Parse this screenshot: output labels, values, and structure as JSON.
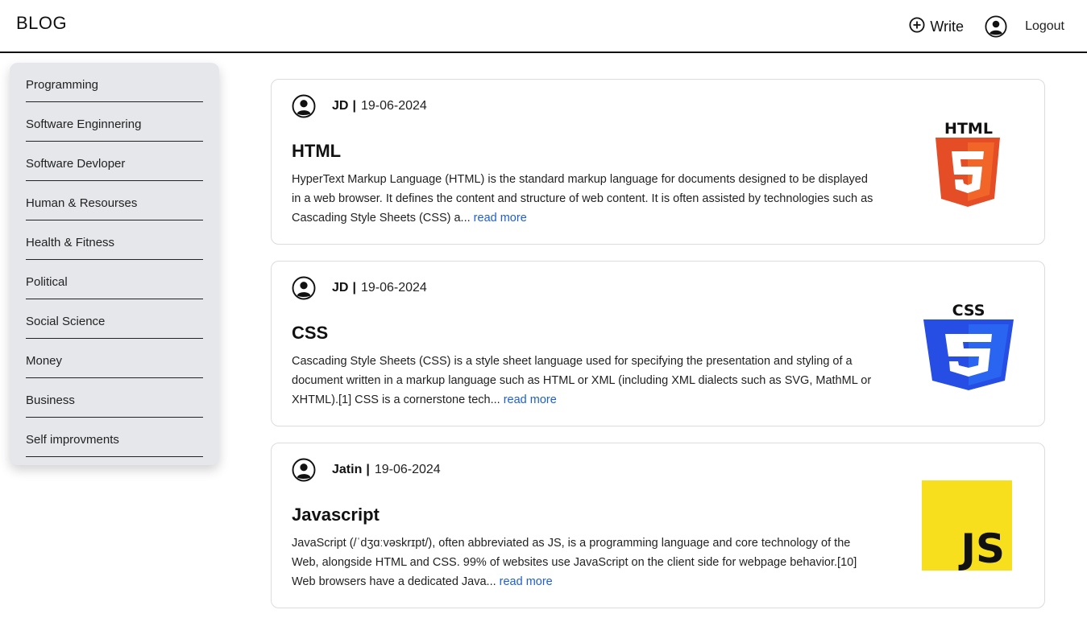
{
  "header": {
    "brand": "BLOG",
    "write_label": "Write",
    "logout_label": "Logout"
  },
  "sidebar": {
    "items": [
      {
        "label": "Programming"
      },
      {
        "label": "Software Enginnering"
      },
      {
        "label": "Software Devloper"
      },
      {
        "label": "Human & Resourses"
      },
      {
        "label": "Health & Fitness"
      },
      {
        "label": "Political"
      },
      {
        "label": "Social Science"
      },
      {
        "label": "Money"
      },
      {
        "label": "Business"
      },
      {
        "label": "Self improvments"
      }
    ]
  },
  "posts": [
    {
      "author": "JD",
      "separator": "|",
      "date": "19-06-2024",
      "title": "HTML",
      "excerpt": "HyperText Markup Language (HTML) is the standard markup language for documents designed to be displayed in a web browser. It defines the content and structure of web content. It is often assisted by technologies such as Cascading Style Sheets (CSS) a...",
      "read_more": "read more",
      "thumbnail": "html5-logo",
      "thumbnail_text": "HTML",
      "thumbnail_color": "#e44d26"
    },
    {
      "author": "JD",
      "separator": "|",
      "date": "19-06-2024",
      "title": "CSS",
      "excerpt": "Cascading Style Sheets (CSS) is a style sheet language used for specifying the presentation and styling of a document written in a markup language such as HTML or XML (including XML dialects such as SVG, MathML or XHTML).[1] CSS is a cornerstone tech...",
      "read_more": "read more",
      "thumbnail": "css3-logo",
      "thumbnail_text": "CSS",
      "thumbnail_color": "#264de4"
    },
    {
      "author": "Jatin",
      "separator": "|",
      "date": "19-06-2024",
      "title": "Javascript",
      "excerpt": "JavaScript (/ˈdʒɑːvəskrɪpt/), often abbreviated as JS, is a programming language and core technology of the Web, alongside HTML and CSS. 99% of websites use JavaScript on the client side for webpage behavior.[10] Web browsers have a dedicated Java...",
      "read_more": "read more",
      "thumbnail": "js-logo",
      "thumbnail_text": "JS",
      "thumbnail_color": "#f7df1e"
    }
  ],
  "colors": {
    "accent_link": "#1d5fd1",
    "sidebar_bg": "#e5e7eb",
    "header_border": "#111111"
  }
}
